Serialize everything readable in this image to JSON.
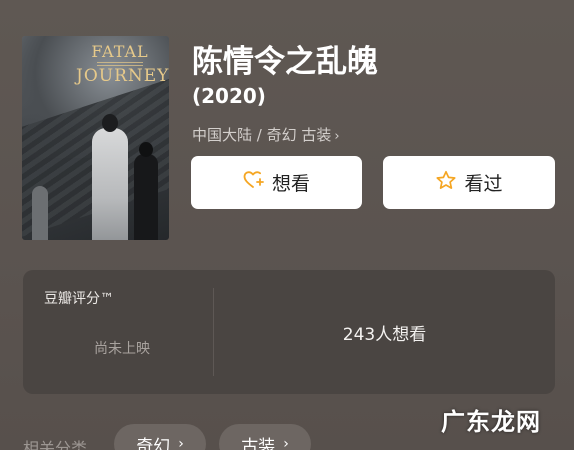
{
  "poster": {
    "title_line1": "FATAL",
    "title_line2": "JOURNEY"
  },
  "movie": {
    "title": "陈情令之乱魄",
    "year": "(2020)",
    "meta": "中国大陆 / 奇幻 古装",
    "meta_chevron": "›"
  },
  "actions": {
    "want_label": "想看",
    "seen_label": "看过",
    "accent": "#f5a623"
  },
  "rating": {
    "label": "豆瓣评分™",
    "status": "尚未上映",
    "want_count": "243人想看"
  },
  "related": {
    "label": "相关分类",
    "tags": [
      {
        "label": "奇幻",
        "chevron": "›"
      },
      {
        "label": "古装",
        "chevron": "›"
      }
    ]
  },
  "watermark": "广东龙网",
  "icons": {
    "want": "heart-plus-icon",
    "seen": "star-outline-icon"
  }
}
